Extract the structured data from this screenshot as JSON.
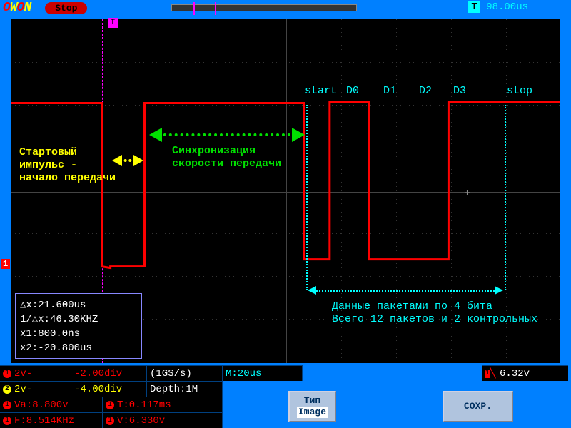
{
  "header": {
    "logo": "OWON",
    "status": "Stop",
    "time_offset": "98.00us"
  },
  "annotations": {
    "bit_labels": [
      "start",
      "D0",
      "D1",
      "D2",
      "D3",
      "stop"
    ],
    "start_pulse_line1": "Стартовый",
    "start_pulse_line2": "импульс -",
    "start_pulse_line3": "начало передачи",
    "sync_line1": "Синхронизация",
    "sync_line2": "скорости передачи",
    "packet_line1": "Данные пакетами по 4 бита",
    "packet_line2": "Всего 12 пакетов и 2 контрольных"
  },
  "cursors": {
    "dx": "△x:21.600us",
    "freq": "1/△x:46.30KHZ",
    "x1": "x1:800.0ns",
    "x2": "x2:-20.800us"
  },
  "footer": {
    "ch1_couple": "2v-",
    "ch1_div": "-2.00div",
    "ch2_couple": "2v-",
    "ch2_div": "-4.00div",
    "sample_rate": "(1GS/s)",
    "depth": "Depth:1M",
    "timebase": "M:20us",
    "va": "Va:8.800v",
    "t_period": "T:0.117ms",
    "freq": "F:8.514KHz",
    "volt": "V:6.330v",
    "trig": "6.32v",
    "menu_type_label": "Тип",
    "menu_type_value": "Image",
    "menu_save": "COXP."
  }
}
